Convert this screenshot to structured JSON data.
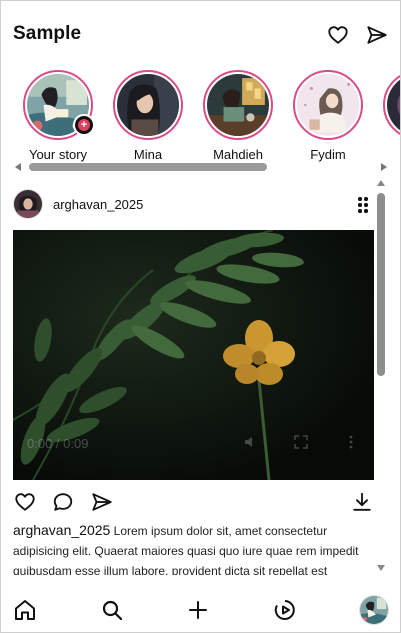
{
  "header": {
    "title": "Sample",
    "icons": [
      "heart-icon",
      "send-icon"
    ]
  },
  "stories": [
    {
      "label": "Your story",
      "own": true
    },
    {
      "label": "Mina"
    },
    {
      "label": "Mahdieh"
    },
    {
      "label": "Fydim"
    },
    {
      "label": ""
    }
  ],
  "post": {
    "username": "arghavan_2025",
    "video": {
      "time_label": "0:00 / 0:09"
    },
    "caption": {
      "username": "arghavan_2025",
      "text": "Lorem ipsum dolor sit, amet consectetur adipisicing elit. Quaerat maiores quasi quo iure quae rem impedit quibusdam esse illum labore, provident dicta sit repellat est dolores"
    }
  },
  "bottom_nav": {
    "items": [
      "home-icon",
      "search-icon",
      "add-icon",
      "reels-icon",
      "profile-avatar"
    ]
  },
  "colors": {
    "story_ring": "#d94c8a",
    "accent_text": "#111111",
    "scrollbar": "#9a9a9a"
  }
}
